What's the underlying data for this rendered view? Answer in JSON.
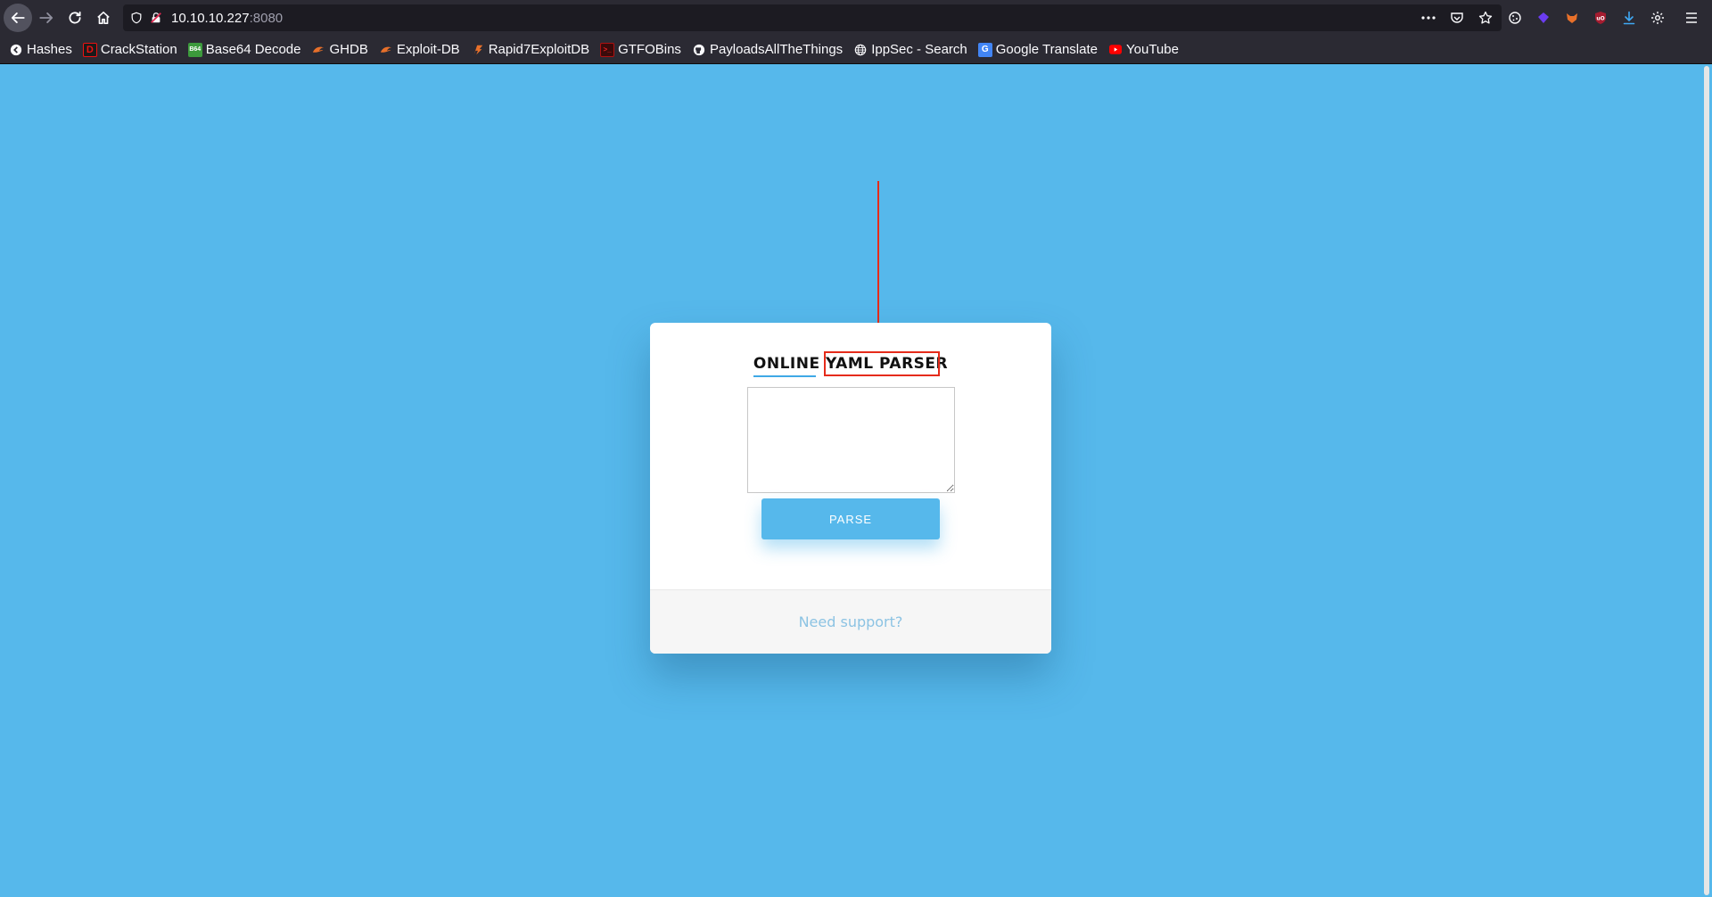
{
  "browser": {
    "url_host": "10.10.10.227",
    "url_port": ":8080"
  },
  "bookmarks": [
    {
      "label": "Hashes",
      "icon": "hashes-icon",
      "color": "#ffffff"
    },
    {
      "label": "CrackStation",
      "icon": "crackstation-icon",
      "color": "#cc0000"
    },
    {
      "label": "Base64 Decode",
      "icon": "base64-icon",
      "color": "#3c9a3c"
    },
    {
      "label": "GHDB",
      "icon": "ghdb-icon",
      "color": "#e8702a"
    },
    {
      "label": "Exploit-DB",
      "icon": "exploitdb-icon",
      "color": "#e8702a"
    },
    {
      "label": "Rapid7ExploitDB",
      "icon": "rapid7-icon",
      "color": "#e8702a"
    },
    {
      "label": "GTFOBins",
      "icon": "gtfobins-icon",
      "color": "#b01010"
    },
    {
      "label": "PayloadsAllTheThings",
      "icon": "github-icon",
      "color": "#ffffff"
    },
    {
      "label": "IppSec - Search",
      "icon": "globe-icon",
      "color": "#ffffff"
    },
    {
      "label": "Google Translate",
      "icon": "google-translate-icon",
      "color": "#4285f4"
    },
    {
      "label": "YouTube",
      "icon": "youtube-icon",
      "color": "#ff0000"
    }
  ],
  "page": {
    "title_first": "ONLINE",
    "title_second": "YAML PARSER",
    "input_value": "",
    "parse_label": "PARSE",
    "support_label": "Need support?",
    "accent_color": "#56b8eb",
    "annotation_color": "#e52b1a"
  }
}
